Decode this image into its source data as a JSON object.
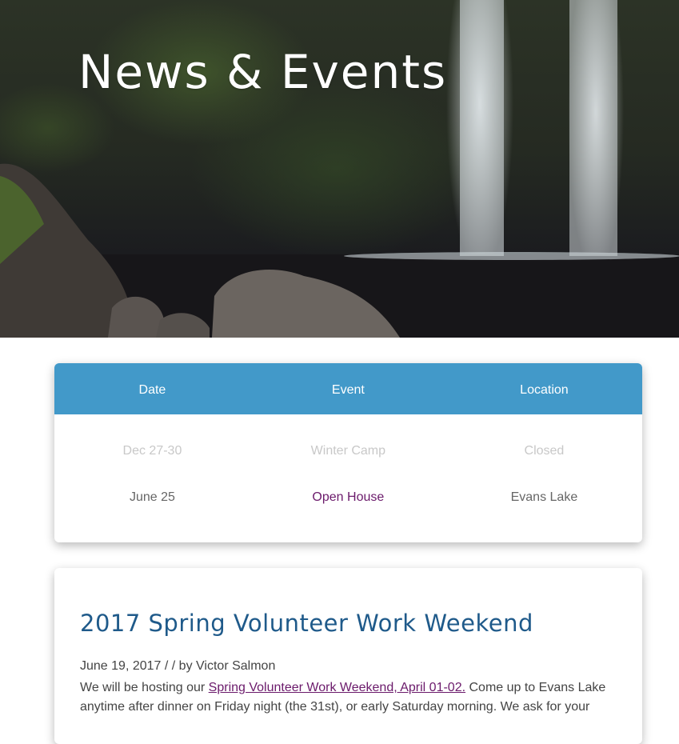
{
  "hero": {
    "title": "News & Events"
  },
  "events_table": {
    "headers": {
      "date": "Date",
      "event": "Event",
      "location": "Location"
    },
    "rows": [
      {
        "date": "Dec 27-30",
        "event": "Winter Camp",
        "location": "Closed",
        "state": "past"
      },
      {
        "date": "June 25",
        "event": "Open House",
        "location": "Evans Lake",
        "state": "upcoming"
      }
    ]
  },
  "post": {
    "title": "2017 Spring Volunteer Work Weekend",
    "date": "June 19, 2017",
    "separator": "/ /",
    "by": "by",
    "author": "Victor Salmon",
    "body_intro": "We will be hosting our ",
    "body_link": "Spring Volunteer Work Weekend, April 01-02.",
    "body_rest": " Come up to Evans Lake anytime after dinner on Friday night (the 31st), or early Saturday morning. We ask for your"
  },
  "colors": {
    "table_header": "#4299c9",
    "post_title": "#1f5a8a",
    "link": "#6b1a6b"
  }
}
